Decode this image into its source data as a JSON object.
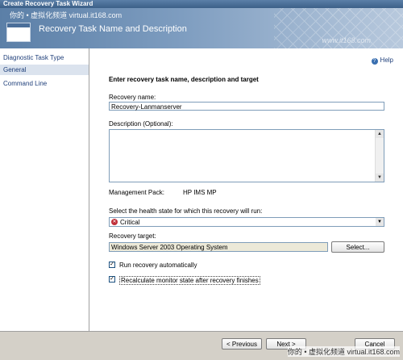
{
  "window": {
    "title": "Create Recovery Task Wizard"
  },
  "watermark": {
    "top": "你的 • 虚拟化频道  virtual.it168.com",
    "bottom": "你的 • 虚拟化频道  virtual.it168.com",
    "header_right": "www.it168.com"
  },
  "header": {
    "title": "Recovery Task Name and Description"
  },
  "sidebar": {
    "items": [
      {
        "label": "Diagnostic Task Type"
      },
      {
        "label": "General"
      },
      {
        "label": "Command Line"
      }
    ]
  },
  "help": {
    "label": "Help"
  },
  "form": {
    "section_title": "Enter recovery task name, description and target",
    "name_label": "Recovery name:",
    "name_value": "Recovery-Lanmanserver",
    "description_label": "Description (Optional):",
    "management_pack_label": "Management Pack:",
    "management_pack_value": "HP IMS MP",
    "health_state_label": "Select the health state for which this recovery will run:",
    "health_state_value": "Critical",
    "target_label": "Recovery target:",
    "target_value": "Windows Server 2003 Operating System",
    "select_button": "Select...",
    "run_auto_label": "Run recovery automatically",
    "run_auto_checked": "✓",
    "recalc_label": "Recalculate monitor state after recovery finishes",
    "recalc_checked": "✓"
  },
  "buttons": {
    "previous": "< Previous",
    "next": "Next >",
    "cancel": "Cancel"
  },
  "icons": {
    "help": "help-icon",
    "critical": "critical-icon",
    "dropdown": "chevron-down-icon"
  }
}
